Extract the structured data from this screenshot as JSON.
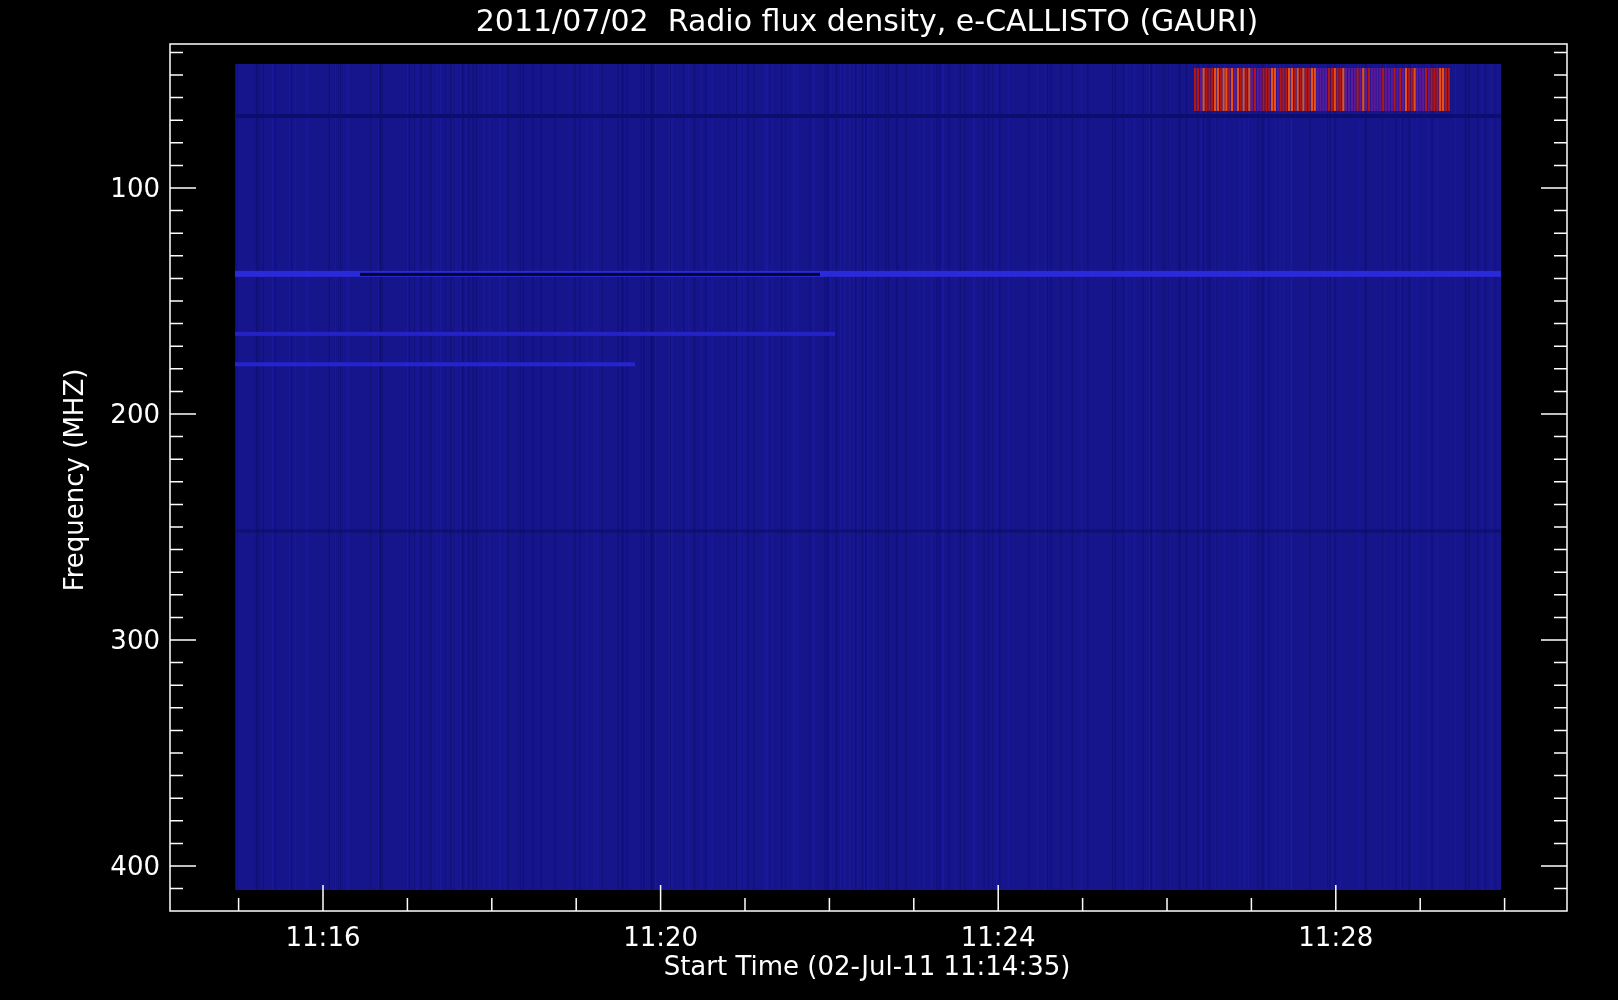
{
  "title": "2011/07/02  Radio flux density, e-CALLISTO (GAURI)",
  "y_axis": {
    "label": "Frequency (MHZ)",
    "ticks": [
      "100",
      "200",
      "300",
      "400"
    ]
  },
  "x_axis": {
    "label": "Start Time (02-Jul-11 11:14:35)",
    "ticks": [
      "11:16",
      "11:20",
      "11:24",
      "11:28"
    ]
  }
}
